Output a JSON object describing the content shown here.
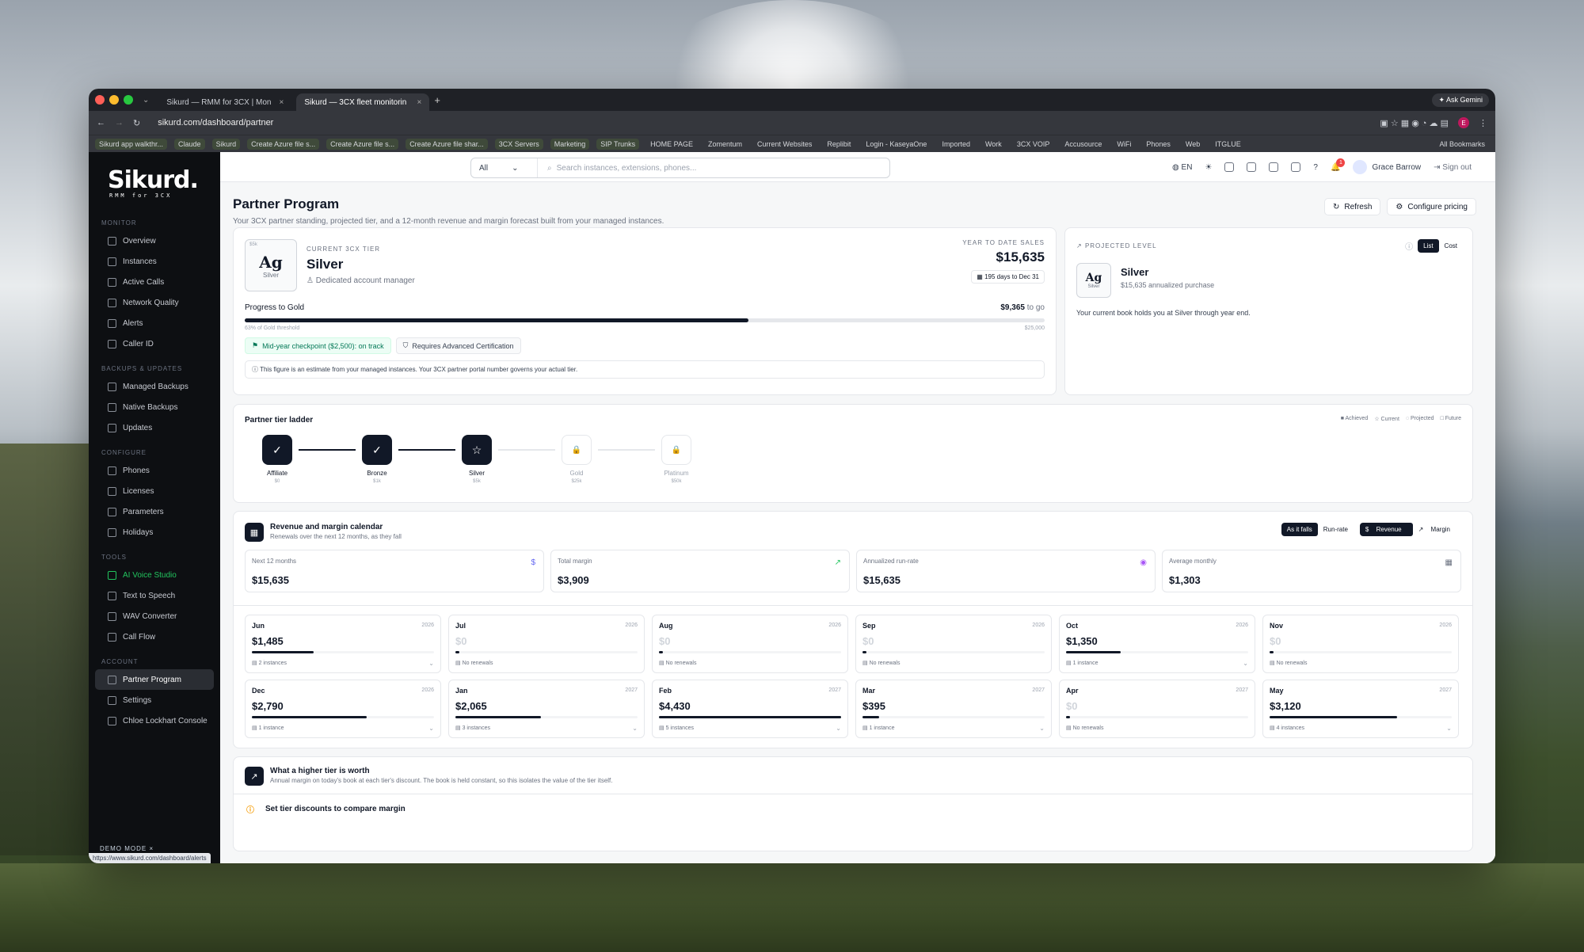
{
  "browser": {
    "tabs": [
      {
        "label": "Sikurd — RMM for 3CX | Mon"
      },
      {
        "label": "Sikurd — 3CX fleet monitorin"
      }
    ],
    "url": "sikurd.com/dashboard/partner",
    "ask_gemini": "Ask Gemini",
    "profile_initial": "E",
    "bookmarks": [
      "Sikurd app walkthr...",
      "Claude",
      "Sikurd",
      "Create Azure file s...",
      "Create Azure file s...",
      "Create Azure file shar...",
      "3CX Servers",
      "Marketing",
      "SIP Trunks",
      "HOME PAGE",
      "Zomentum",
      "Current Websites",
      "Replibit",
      "Login - KaseyaOne",
      "Imported",
      "Work",
      "3CX VOIP",
      "Accusource",
      "WiFi",
      "Phones",
      "Web",
      "ITGLUE"
    ],
    "all_bookmarks": "All Bookmarks",
    "status_url": "https://www.sikurd.com/dashboard/alerts"
  },
  "sidebar": {
    "logo": "Sikurd.",
    "logo_sub": "RMM for 3CX",
    "sections": [
      {
        "title": "MONITOR",
        "items": [
          "Overview",
          "Instances",
          "Active Calls",
          "Network Quality",
          "Alerts",
          "Caller ID"
        ]
      },
      {
        "title": "BACKUPS & UPDATES",
        "items": [
          "Managed Backups",
          "Native Backups",
          "Updates"
        ]
      },
      {
        "title": "CONFIGURE",
        "items": [
          "Phones",
          "Licenses",
          "Parameters",
          "Holidays"
        ]
      },
      {
        "title": "TOOLS",
        "items": [
          "AI Voice Studio",
          "Text to Speech",
          "WAV Converter",
          "Call Flow"
        ]
      },
      {
        "title": "ACCOUNT",
        "items": [
          "Partner Program",
          "Settings",
          "Chloe Lockhart Console"
        ]
      }
    ],
    "demo_mode": "DEMO MODE"
  },
  "topbar": {
    "filter": "All",
    "search_placeholder": "Search instances, extensions, phones...",
    "lang": "EN",
    "notifications": "1",
    "user": "Grace Barrow",
    "signout": "Sign out"
  },
  "page": {
    "title": "Partner Program",
    "subtitle": "Your 3CX partner standing, projected tier, and a 12-month revenue and margin forecast built from your managed instances.",
    "refresh": "Refresh",
    "configure": "Configure pricing"
  },
  "current_tier": {
    "box_tag": "$5k",
    "symbol": "Ag",
    "box_name": "Silver",
    "label": "CURRENT 3CX TIER",
    "name": "Silver",
    "perk": "Dedicated account manager",
    "ytd_label": "YEAR TO DATE SALES",
    "ytd_value": "$15,635",
    "days_left": "195 days to Dec 31",
    "progress_label": "Progress to Gold",
    "to_go_amount": "$9,365",
    "to_go_suffix": "to go",
    "progress_pct": 63,
    "threshold_note": "63% of Gold threshold",
    "threshold_value": "$25,000",
    "checkpoint": "Mid-year checkpoint ($2,500): on track",
    "requirement": "Requires Advanced Certification",
    "disclaimer": "This figure is an estimate from your managed instances. Your 3CX partner portal number governs your actual tier."
  },
  "projected": {
    "label": "PROJECTED LEVEL",
    "seg": [
      "List",
      "Cost"
    ],
    "box_tag": "$5k",
    "symbol": "Ag",
    "box_name": "Silver",
    "name": "Silver",
    "detail": "$15,635 annualized purchase",
    "note": "Your current book holds you at Silver through year end."
  },
  "ladder": {
    "title": "Partner tier ladder",
    "legend": [
      "Achieved",
      "Current",
      "Projected",
      "Future"
    ],
    "tiers": [
      {
        "name": "Affiliate",
        "amount": "$0",
        "state": "achieved"
      },
      {
        "name": "Bronze",
        "amount": "$1k",
        "state": "achieved"
      },
      {
        "name": "Silver",
        "amount": "$5k",
        "state": "current"
      },
      {
        "name": "Gold",
        "amount": "$25k",
        "state": "future"
      },
      {
        "name": "Platinum",
        "amount": "$50k",
        "state": "future"
      }
    ]
  },
  "calendar": {
    "title": "Revenue and margin calendar",
    "subtitle": "Renewals over the next 12 months, as they fall",
    "view_toggle": [
      "As it falls",
      "Run-rate"
    ],
    "metric_toggle": [
      "Revenue",
      "Margin"
    ],
    "kpis": [
      {
        "label": "Next 12 months",
        "value": "$15,635"
      },
      {
        "label": "Total margin",
        "value": "$3,909"
      },
      {
        "label": "Annualized run-rate",
        "value": "$15,635"
      },
      {
        "label": "Average monthly",
        "value": "$1,303"
      }
    ],
    "months": [
      {
        "month": "Jun",
        "year": "2026",
        "value": "$1,485",
        "instances": "2 instances",
        "fill": 0.34
      },
      {
        "month": "Jul",
        "year": "2026",
        "value": "$0",
        "instances": "No renewals",
        "fill": 0.02
      },
      {
        "month": "Aug",
        "year": "2026",
        "value": "$0",
        "instances": "No renewals",
        "fill": 0.02
      },
      {
        "month": "Sep",
        "year": "2026",
        "value": "$0",
        "instances": "No renewals",
        "fill": 0.02
      },
      {
        "month": "Oct",
        "year": "2026",
        "value": "$1,350",
        "instances": "1 instance",
        "fill": 0.3
      },
      {
        "month": "Nov",
        "year": "2026",
        "value": "$0",
        "instances": "No renewals",
        "fill": 0.02
      },
      {
        "month": "Dec",
        "year": "2026",
        "value": "$2,790",
        "instances": "1 instance",
        "fill": 0.63
      },
      {
        "month": "Jan",
        "year": "2027",
        "value": "$2,065",
        "instances": "3 instances",
        "fill": 0.47
      },
      {
        "month": "Feb",
        "year": "2027",
        "value": "$4,430",
        "instances": "5 instances",
        "fill": 1.0
      },
      {
        "month": "Mar",
        "year": "2027",
        "value": "$395",
        "instances": "1 instance",
        "fill": 0.09
      },
      {
        "month": "Apr",
        "year": "2027",
        "value": "$0",
        "instances": "No renewals",
        "fill": 0.02
      },
      {
        "month": "May",
        "year": "2027",
        "value": "$3,120",
        "instances": "4 instances",
        "fill": 0.7
      }
    ]
  },
  "higher_tier": {
    "title": "What a higher tier is worth",
    "subtitle": "Annual margin on today's book at each tier's discount. The book is held constant, so this isolates the value of the tier itself.",
    "prompt": "Set tier discounts to compare margin"
  }
}
